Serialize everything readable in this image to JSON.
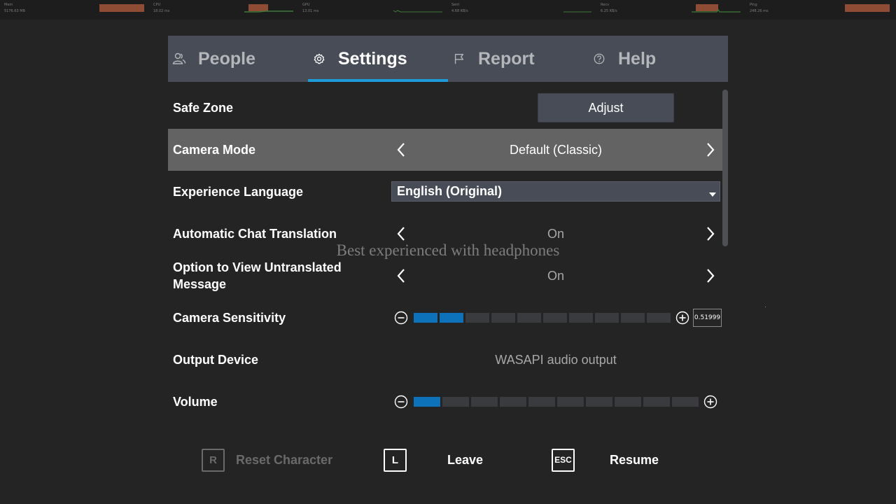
{
  "stats": [
    {
      "label": "Mem",
      "value": "5176.63 MB"
    },
    {
      "label": "CPU",
      "value": "18.02 ms"
    },
    {
      "label": "GPU",
      "value": "13.01 ms"
    },
    {
      "label": "Sent",
      "value": "4.68 KB/s"
    },
    {
      "label": "Recv",
      "value": "6.25 KB/s"
    },
    {
      "label": "Ping",
      "value": "248.26 ms"
    }
  ],
  "tabs": [
    {
      "label": "People",
      "icon": "people-icon"
    },
    {
      "label": "Settings",
      "icon": "gear-icon",
      "active": true
    },
    {
      "label": "Report",
      "icon": "flag-icon"
    },
    {
      "label": "Help",
      "icon": "question-icon"
    }
  ],
  "settings": {
    "safe_zone": {
      "label": "Safe Zone",
      "button": "Adjust"
    },
    "camera_mode": {
      "label": "Camera Mode",
      "value": "Default (Classic)"
    },
    "experience_language": {
      "label": "Experience Language",
      "value": "English (Original)"
    },
    "auto_chat_translation": {
      "label": "Automatic Chat Translation",
      "value": "On"
    },
    "view_untranslated": {
      "label": "Option to View Untranslated Message",
      "value": "On"
    },
    "camera_sensitivity": {
      "label": "Camera Sensitivity",
      "value": "0.51999",
      "segments": 10,
      "filled": 2
    },
    "output_device": {
      "label": "Output Device",
      "value": "WASAPI audio output"
    },
    "volume": {
      "label": "Volume",
      "segments": 10,
      "filled": 1
    }
  },
  "hint": "Best experienced with headphones",
  "actions": [
    {
      "key": "R",
      "label": "Reset Character",
      "enabled": false
    },
    {
      "key": "L",
      "label": "Leave",
      "enabled": true
    },
    {
      "key": "ESC",
      "label": "Resume",
      "enabled": true
    }
  ],
  "colors": {
    "accent": "#1d9bd8",
    "slider_on": "#0d72b9",
    "tabbar": "#474c56",
    "highlight_row": "#636363"
  }
}
